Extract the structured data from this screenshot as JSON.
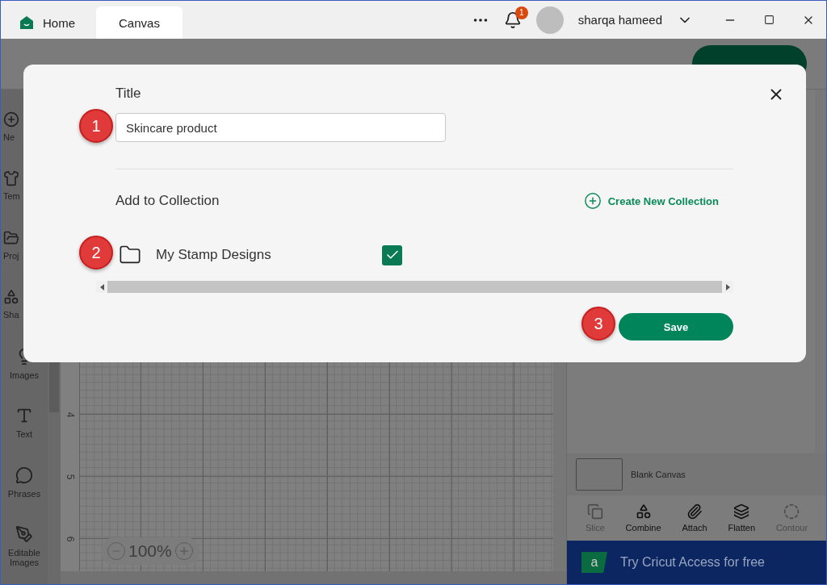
{
  "window": {
    "tabs": [
      {
        "label": "Home",
        "selected": false
      },
      {
        "label": "Canvas",
        "selected": true
      }
    ],
    "notifications": "1",
    "user": "sharqa hameed"
  },
  "sidebar": {
    "items": [
      {
        "label": "Ne"
      },
      {
        "label": "Tem"
      },
      {
        "label": "Proj"
      },
      {
        "label": "Sha"
      },
      {
        "label": "Images"
      },
      {
        "label": "Text"
      },
      {
        "label": "Phrases"
      },
      {
        "label": "Editable Images"
      }
    ]
  },
  "canvas": {
    "ruler": [
      "4",
      "5",
      "6"
    ],
    "zoom": "100%"
  },
  "panel": {
    "layer": "Blank Canvas",
    "tools": [
      {
        "label": "Slice",
        "disabled": true
      },
      {
        "label": "Combine",
        "disabled": false
      },
      {
        "label": "Attach",
        "disabled": false
      },
      {
        "label": "Flatten",
        "disabled": false
      },
      {
        "label": "Contour",
        "disabled": true
      }
    ],
    "banner_logo": "a",
    "banner": "Try Cricut Access for free"
  },
  "dialog": {
    "title_label": "Title",
    "title_value": "Skincare product",
    "collection_label": "Add to Collection",
    "create_link": "Create New Collection",
    "collections": [
      {
        "name": "My Stamp Designs",
        "checked": true
      }
    ],
    "save": "Save",
    "markers": [
      "1",
      "2",
      "3"
    ]
  }
}
